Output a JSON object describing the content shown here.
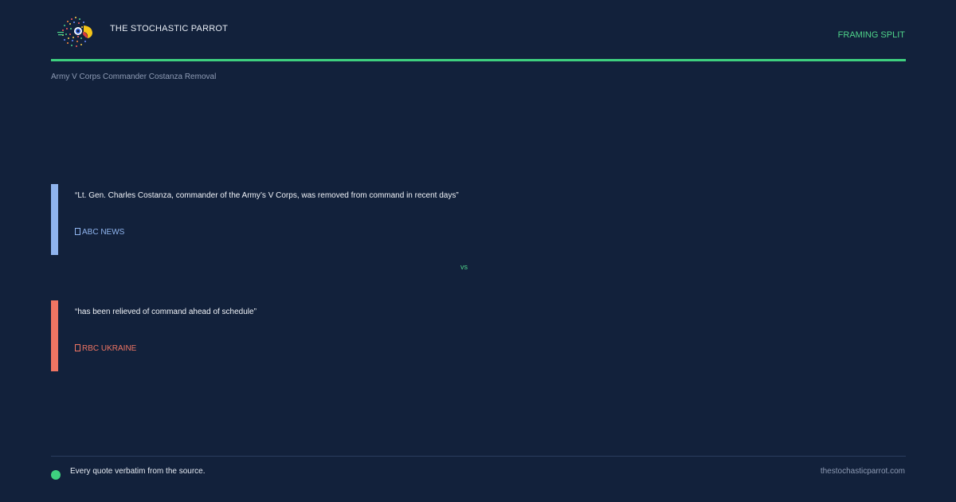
{
  "header": {
    "brand": "THE STOCHASTIC PARROT",
    "page_type": "FRAMING SPLIT",
    "logo_icon": "parrot-logo-icon"
  },
  "topic": "Army V Corps Commander Costanza Removal",
  "comparison": {
    "vs_label": "vs",
    "quotes": [
      {
        "text": "“Lt. Gen. Charles Costanza, commander of the Army’s V Corps, was removed from command in recent days”",
        "source": "ABC NEWS",
        "color": "#8fb4ee"
      },
      {
        "text": "“has been relieved of command ahead of schedule”",
        "source": "RBC UKRAINE",
        "color": "#ef7563"
      }
    ]
  },
  "footer": {
    "note": "Every quote verbatim from the source.",
    "site": "thestochasticparrot.com"
  },
  "colors": {
    "background": "#12213b",
    "accent": "#3ed07f"
  }
}
